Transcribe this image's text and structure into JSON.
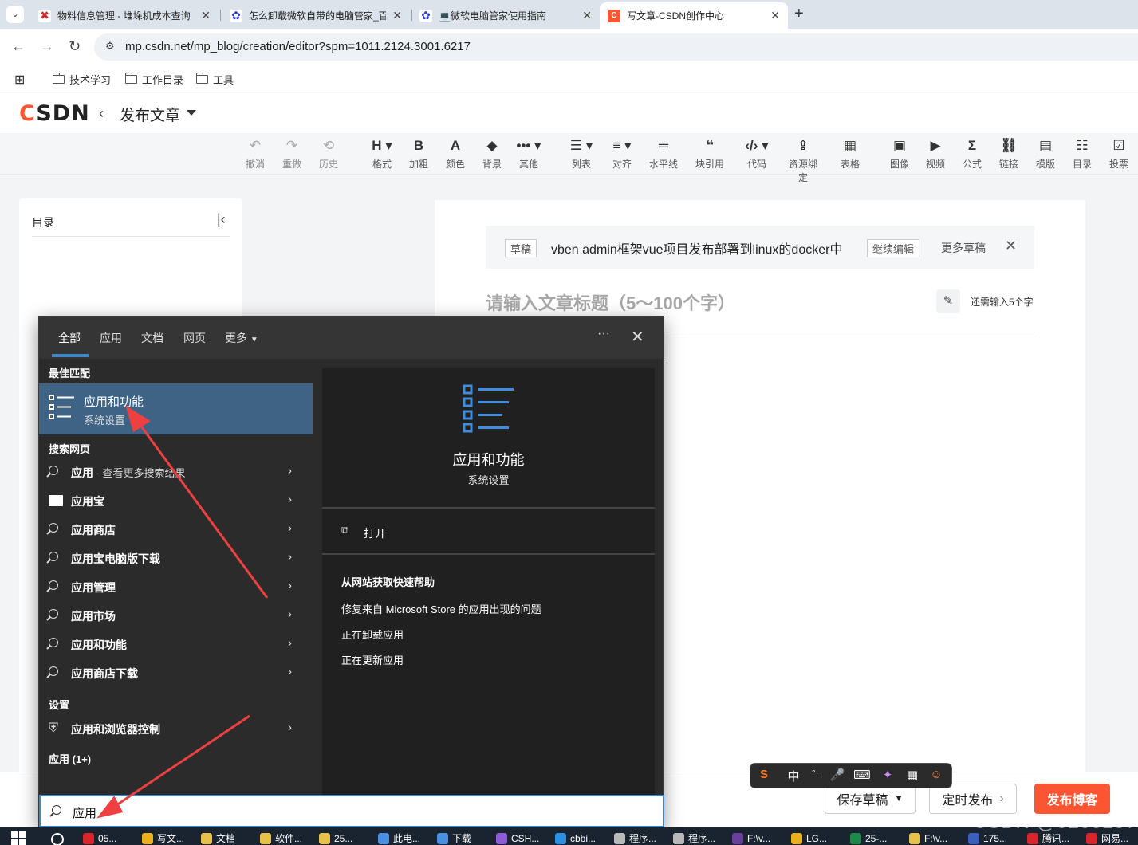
{
  "browser": {
    "tabs": [
      {
        "title": "物料信息管理 - 堆垛机成本查询",
        "favicon_color": "#d9262c",
        "favicon_text": "✖"
      },
      {
        "title": "怎么卸载微软自带的电脑管家_百度",
        "favicon_color": "#2d3ed6",
        "favicon_text": "✿"
      },
      {
        "title": "💻微软电脑管家使用指南",
        "favicon_color": "#2d3ed6",
        "favicon_text": "✿"
      },
      {
        "title": "写文章-CSDN创作中心",
        "favicon_color": "#fc5531",
        "favicon_text": "C"
      }
    ],
    "url": "mp.csdn.net/mp_blog/creation/editor?spm=1011.2124.3001.6217",
    "bookmarks": [
      "技术学习",
      "工作目录",
      "工具"
    ]
  },
  "csdn": {
    "logo_prefix": "C",
    "logo_rest": "SDN",
    "page_title": "发布文章",
    "toolbar": [
      {
        "icon": "↶",
        "label": "撤消",
        "disabled": true
      },
      {
        "icon": "↷",
        "label": "重做",
        "disabled": true
      },
      {
        "icon": "⟲",
        "label": "历史",
        "disabled": true
      },
      {
        "icon": "H ▾",
        "label": "格式"
      },
      {
        "icon": "B",
        "label": "加粗"
      },
      {
        "icon": "A",
        "label": "颜色"
      },
      {
        "icon": "◆",
        "label": "背景"
      },
      {
        "icon": "••• ▾",
        "label": "其他"
      },
      {
        "icon": "☰ ▾",
        "label": "列表"
      },
      {
        "icon": "≡ ▾",
        "label": "对齐"
      },
      {
        "icon": "═",
        "label": "水平线"
      },
      {
        "icon": "❝",
        "label": "块引用"
      },
      {
        "icon": "‹/› ▾",
        "label": "代码"
      },
      {
        "icon": "⇪",
        "label": "资源绑定"
      },
      {
        "icon": "▦",
        "label": "表格"
      },
      {
        "icon": "▣",
        "label": "图像"
      },
      {
        "icon": "▶",
        "label": "视频"
      },
      {
        "icon": "Σ",
        "label": "公式"
      },
      {
        "icon": "⛓",
        "label": "链接"
      },
      {
        "icon": "▤",
        "label": "模版"
      },
      {
        "icon": "☷",
        "label": "目录"
      },
      {
        "icon": "☑",
        "label": "投票"
      }
    ],
    "toc": {
      "title": "目录"
    },
    "draft": {
      "tag": "草稿",
      "name": "vben admin框架vue项目发布部署到linux的docker中",
      "continue": "继续编辑",
      "more": "更多草稿"
    },
    "title_placeholder": "请输入文章标题（5～100个字）",
    "remaining": "还需输入5个字",
    "footer": {
      "save": "保存草稿",
      "schedule": "定时发布",
      "publish": "发布博客"
    }
  },
  "ime": {
    "items": [
      "S",
      "中",
      "°,",
      "🎤",
      "⌨",
      "✦",
      "▦",
      "☺"
    ]
  },
  "search": {
    "tabs": [
      "全部",
      "应用",
      "文档",
      "网页",
      "更多"
    ],
    "section_best": "最佳匹配",
    "best": {
      "title": "应用和功能",
      "subtitle": "系统设置"
    },
    "section_web": "搜索网页",
    "web_results": [
      {
        "text": "应用",
        "sub": " - 查看更多搜索结果",
        "icon": "lens"
      },
      {
        "text": "应用宝",
        "sub": "",
        "icon": "app"
      },
      {
        "text": "应用商店",
        "sub": "",
        "icon": "lens"
      },
      {
        "text": "应用宝电脑版下载",
        "sub": "",
        "icon": "lens"
      },
      {
        "text": "应用管理",
        "sub": "",
        "icon": "lens"
      },
      {
        "text": "应用市场",
        "sub": "",
        "icon": "lens"
      },
      {
        "text": "应用和功能",
        "sub": "",
        "icon": "lens"
      },
      {
        "text": "应用商店下载",
        "sub": "",
        "icon": "lens"
      }
    ],
    "section_settings": "设置",
    "settings_results": [
      {
        "text": "应用和浏览器控制",
        "icon": "shield"
      }
    ],
    "section_apps": "应用 (1+)",
    "preview": {
      "title": "应用和功能",
      "subtitle": "系统设置",
      "open": "打开",
      "help_title": "从网站获取快速帮助",
      "help_links": [
        "修复来自 Microsoft Store 的应用出现的问题",
        "正在卸载应用",
        "正在更新应用"
      ]
    },
    "query": "应用"
  },
  "taskbar": {
    "apps": [
      {
        "label": "05...",
        "color": "#d9262c"
      },
      {
        "label": "写文...",
        "color": "#e9b21b"
      },
      {
        "label": "文档",
        "color": "#e8c14a"
      },
      {
        "label": "软件...",
        "color": "#e8c14a"
      },
      {
        "label": "25...",
        "color": "#e8c14a"
      },
      {
        "label": "此电...",
        "color": "#4a8fe0"
      },
      {
        "label": "下载",
        "color": "#4a8fe0"
      },
      {
        "label": "CSH...",
        "color": "#8f5bd6"
      },
      {
        "label": "cbbi...",
        "color": "#2f8fe0"
      },
      {
        "label": "程序...",
        "color": "#b9b9b9"
      },
      {
        "label": "程序...",
        "color": "#b9b9b9"
      },
      {
        "label": "F:\\v...",
        "color": "#6b3f9c"
      },
      {
        "label": "LG...",
        "color": "#e9b21b"
      },
      {
        "label": "25-...",
        "color": "#1d8a4a"
      },
      {
        "label": "F:\\v...",
        "color": "#e8c14a"
      },
      {
        "label": "175...",
        "color": "#3a5fc0"
      },
      {
        "label": "腾讯...",
        "color": "#d9262c"
      },
      {
        "label": "网易...",
        "color": "#d9262c"
      }
    ]
  },
  "watermark": "CSDN @9200237"
}
